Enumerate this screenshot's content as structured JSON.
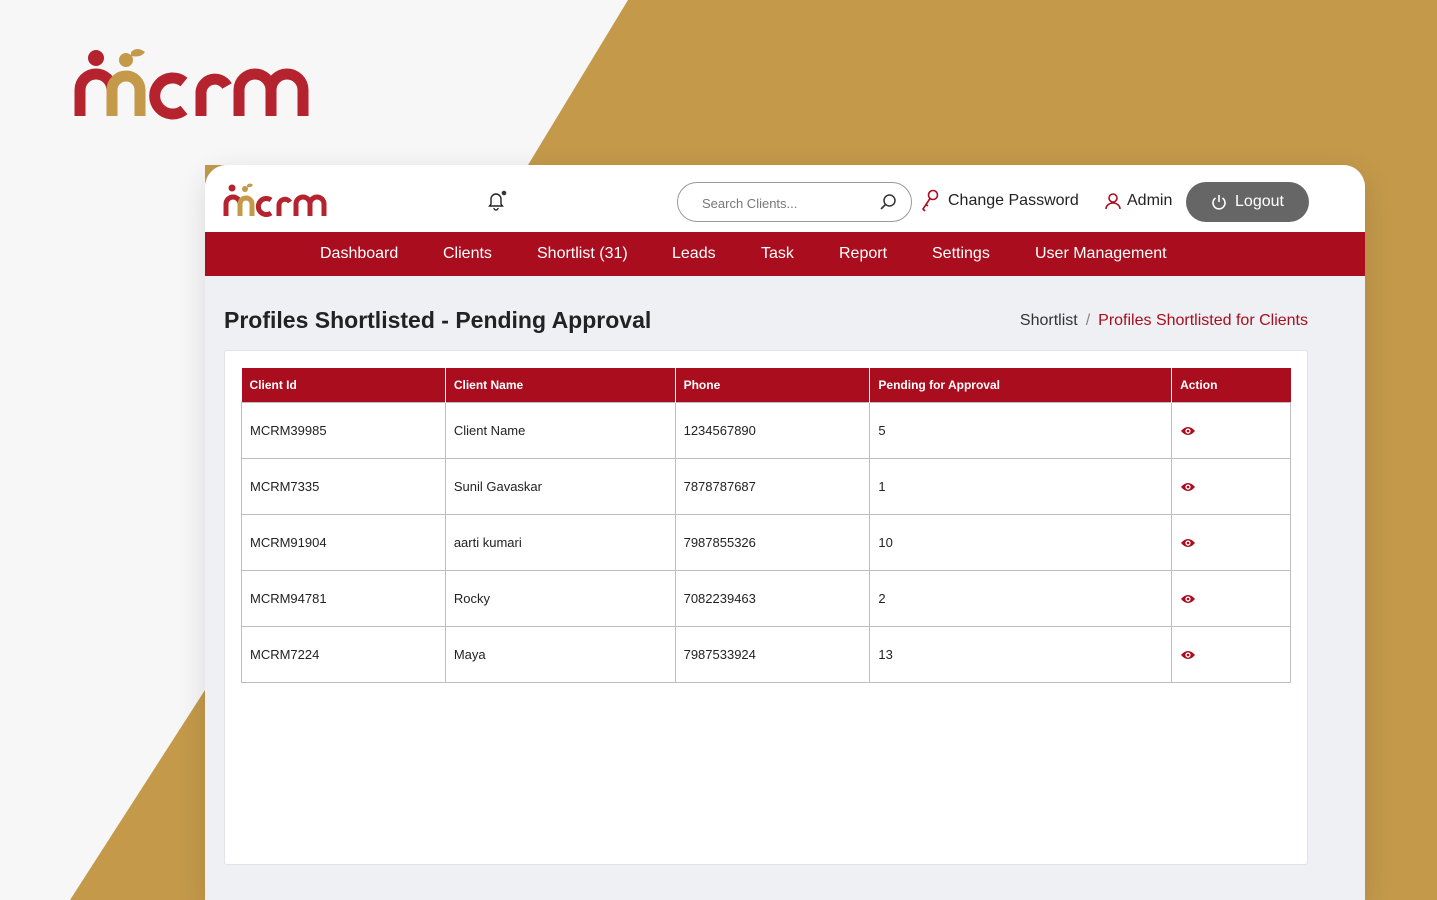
{
  "brand": {
    "name": "mcrm",
    "primary_color": "#a90d1e",
    "accent_color": "#c4994a"
  },
  "header": {
    "search_placeholder": "Search Clients...",
    "change_password_label": "Change Password",
    "user_label": "Admin",
    "logout_label": "Logout"
  },
  "nav": {
    "items": [
      {
        "label": "Dashboard"
      },
      {
        "label": "Clients"
      },
      {
        "label": "Shortlist (31)"
      },
      {
        "label": "Leads"
      },
      {
        "label": "Task"
      },
      {
        "label": "Report"
      },
      {
        "label": "Settings"
      },
      {
        "label": "User Management"
      }
    ]
  },
  "page": {
    "title": "Profiles Shortlisted - Pending Approval",
    "breadcrumb": {
      "parent": "Shortlist",
      "separator": "/",
      "current": "Profiles Shortlisted for Clients"
    }
  },
  "table": {
    "columns": [
      "Client Id",
      "Client Name",
      "Phone",
      "Pending for Approval",
      "Action"
    ],
    "rows": [
      [
        "MCRM39985",
        "Client Name",
        "1234567890",
        "5"
      ],
      [
        "MCRM7335",
        "Sunil Gavaskar",
        "7878787687",
        "1"
      ],
      [
        "MCRM91904",
        "aarti kumari",
        "7987855326",
        "10"
      ],
      [
        "MCRM94781",
        "Rocky",
        "7082239463",
        "2"
      ],
      [
        "MCRM7224",
        "Maya",
        "7987533924",
        "13"
      ]
    ],
    "action_icon": "eye-icon"
  }
}
